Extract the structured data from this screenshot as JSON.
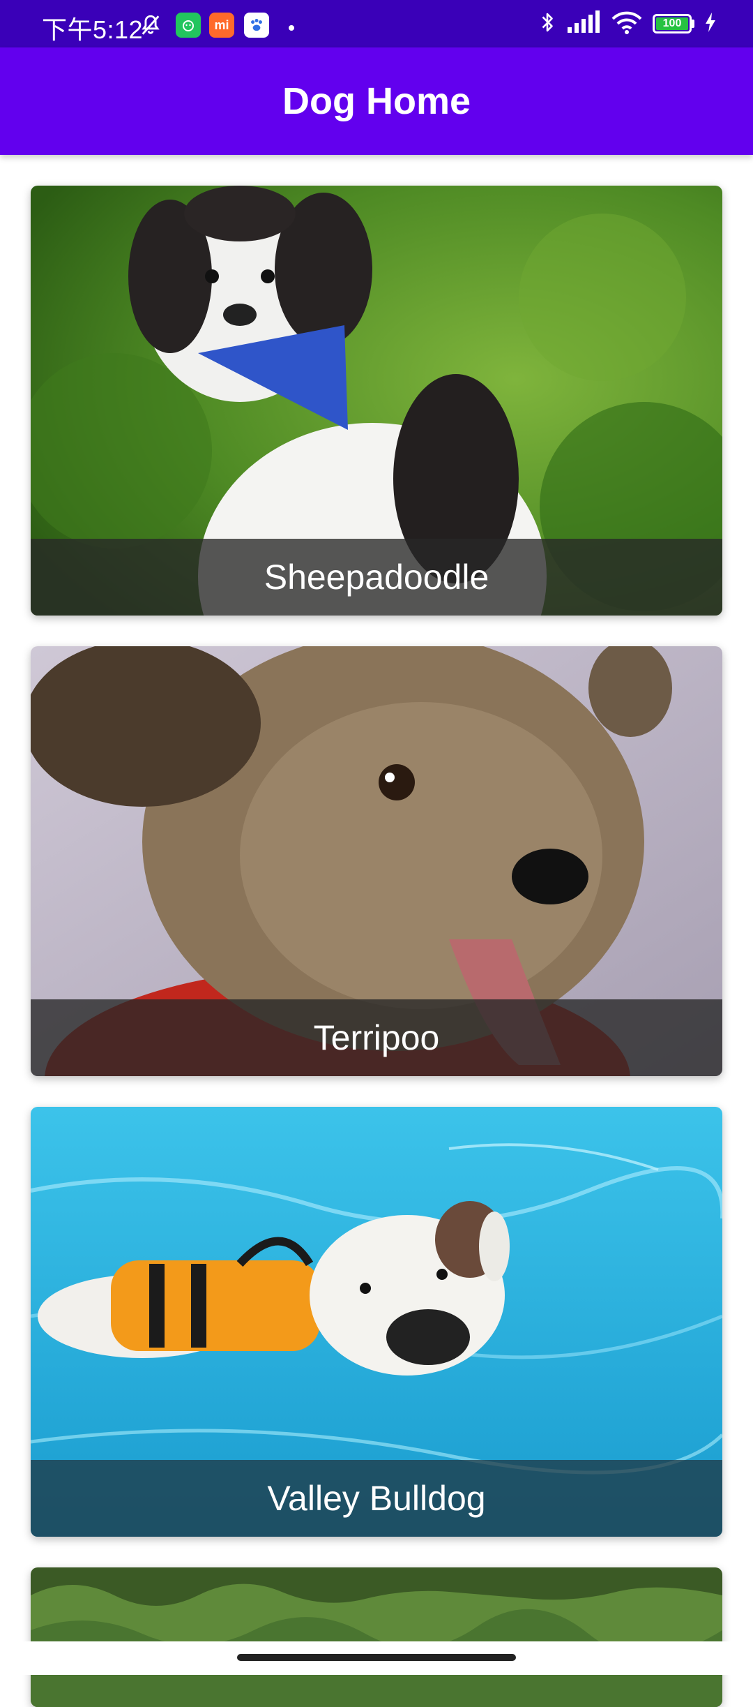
{
  "status_bar": {
    "time": "下午5:12",
    "battery": "100",
    "icons": [
      "mute-bell-icon",
      "app-icon-green",
      "mi-icon",
      "paw-icon",
      "bluetooth-icon",
      "signal-icon",
      "wifi-icon",
      "charging-icon"
    ]
  },
  "app_bar": {
    "title": "Dog Home",
    "color": "#6200ee"
  },
  "dogs": [
    {
      "name": "Sheepadoodle"
    },
    {
      "name": "Terripoo"
    },
    {
      "name": "Valley Bulldog"
    },
    {
      "name": ""
    }
  ]
}
